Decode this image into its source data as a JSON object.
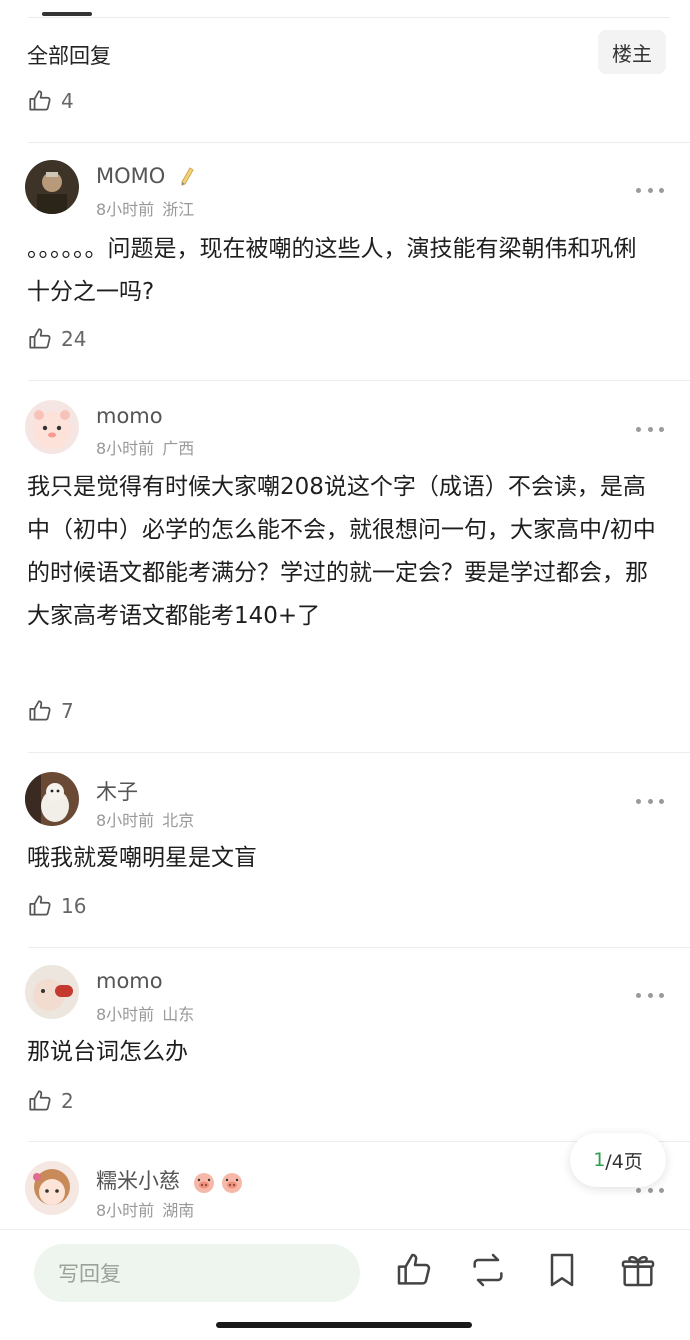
{
  "header": {
    "title": "全部回复",
    "op_button": "楼主"
  },
  "top_like_count": "4",
  "comments": [
    {
      "username": "MOMO",
      "time": "8小时前",
      "location": "浙江",
      "text": "。。。。。。问题是，现在被嘲的这些人，演技能有梁朝伟和巩俐十分之一吗?",
      "likes": "24"
    },
    {
      "username": "momo",
      "time": "8小时前",
      "location": "广西",
      "text": "我只是觉得有时候大家嘲208说这个字（成语）不会读，是高中（初中）必学的怎么能不会，就很想问一句，大家高中/初中的时候语文都能考满分？学过的就一定会？要是学过都会，那大家高考语文都能考140+了",
      "likes": "7"
    },
    {
      "username": "木子",
      "time": "8小时前",
      "location": "北京",
      "text": "哦我就爱嘲明星是文盲",
      "likes": "16"
    },
    {
      "username": "momo",
      "time": "8小时前",
      "location": "山东",
      "text": "那说台词怎么办",
      "likes": "2"
    },
    {
      "username": "糯米小慈",
      "time": "8小时前",
      "location": "湖南"
    }
  ],
  "pagination": {
    "current": "1",
    "total": "/4页"
  },
  "bottom_bar": {
    "reply_placeholder": "写回复"
  },
  "icons": [
    "thumb-up-icon",
    "more-icon",
    "pencil-icon",
    "pig-emoji-icon",
    "repost-icon",
    "bookmark-icon",
    "gift-icon"
  ],
  "colors": {
    "accent_green": "#2e9e4f",
    "input_bg": "#eef5ee"
  }
}
